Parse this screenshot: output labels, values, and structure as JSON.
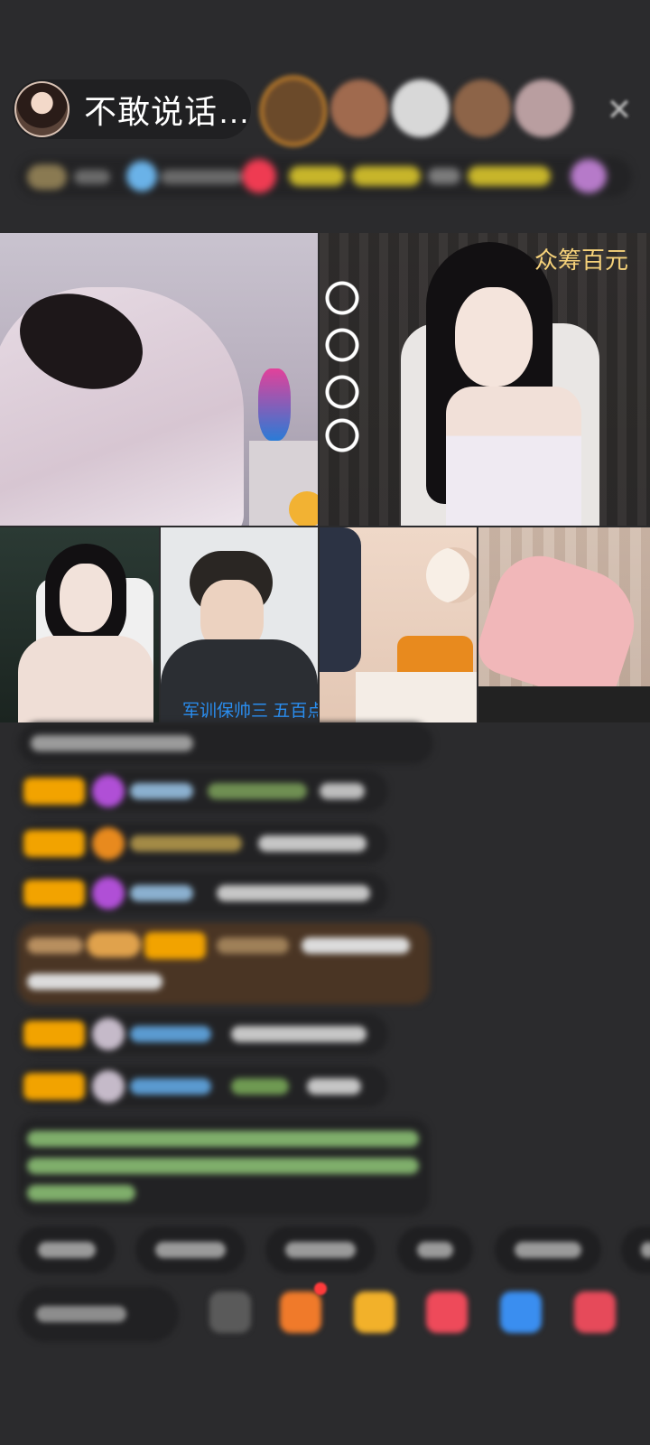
{
  "header": {
    "host_name": "不敢说话…",
    "close_icon": "close-icon"
  },
  "video_grid": {
    "top_right_banner": "众筹百元",
    "bottom_second_caption": "军训保帅三 五百点"
  },
  "colors": {
    "background": "#2b2b2d",
    "badge": "#f2a300",
    "caption_blue": "#2a8ef0",
    "banner_gold": "#f6d27a"
  }
}
